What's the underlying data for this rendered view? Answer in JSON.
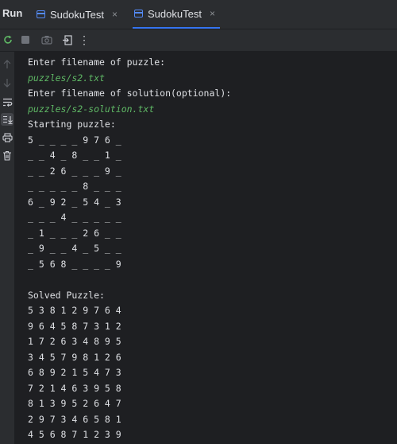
{
  "run_panel": {
    "title": "Run",
    "tabs": [
      {
        "label": "SudokuTest",
        "close": "×"
      },
      {
        "label": "SudokuTest",
        "close": "×"
      }
    ]
  },
  "toolbar": {
    "rerun_icon": "rerun-icon",
    "stop_icon": "stop-icon",
    "screenshot_icon": "camera-icon",
    "exit_icon": "exit-icon",
    "more": "⋮"
  },
  "sidebar": {
    "icons": [
      "up-arrow-icon",
      "down-arrow-icon",
      "soft-wrap-icon",
      "scroll-to-end-icon",
      "print-icon",
      "trash-icon"
    ]
  },
  "console": {
    "lines": [
      {
        "text": "Enter filename of puzzle:",
        "type": "output"
      },
      {
        "text": "puzzles/s2.txt",
        "type": "input"
      },
      {
        "text": "Enter filename of solution(optional):",
        "type": "output"
      },
      {
        "text": "puzzles/s2-solution.txt",
        "type": "input"
      },
      {
        "text": "Starting puzzle:",
        "type": "output"
      },
      {
        "text": "5 _ _ _ _ 9 7 6 _",
        "type": "output"
      },
      {
        "text": "_ _ 4 _ 8 _ _ 1 _",
        "type": "output"
      },
      {
        "text": "_ _ 2 6 _ _ _ 9 _",
        "type": "output"
      },
      {
        "text": "_ _ _ _ _ 8 _ _ _",
        "type": "output"
      },
      {
        "text": "6 _ 9 2 _ 5 4 _ 3",
        "type": "output"
      },
      {
        "text": "_ _ _ 4 _ _ _ _ _",
        "type": "output"
      },
      {
        "text": "_ 1 _ _ _ 2 6 _ _",
        "type": "output"
      },
      {
        "text": "_ 9 _ _ 4 _ 5 _ _",
        "type": "output"
      },
      {
        "text": "_ 5 6 8 _ _ _ _ 9",
        "type": "output"
      },
      {
        "text": "",
        "type": "output"
      },
      {
        "text": "Solved Puzzle:",
        "type": "output"
      },
      {
        "text": "5 3 8 1 2 9 7 6 4",
        "type": "output"
      },
      {
        "text": "9 6 4 5 8 7 3 1 2",
        "type": "output"
      },
      {
        "text": "1 7 2 6 3 4 8 9 5",
        "type": "output"
      },
      {
        "text": "3 4 5 7 9 8 1 2 6",
        "type": "output"
      },
      {
        "text": "6 8 9 2 1 5 4 7 3",
        "type": "output"
      },
      {
        "text": "7 2 1 4 6 3 9 5 8",
        "type": "output"
      },
      {
        "text": "8 1 3 9 5 2 6 4 7",
        "type": "output"
      },
      {
        "text": "2 9 7 3 4 6 5 8 1",
        "type": "output"
      },
      {
        "text": "4 5 6 8 7 1 2 3 9",
        "type": "output"
      }
    ]
  }
}
